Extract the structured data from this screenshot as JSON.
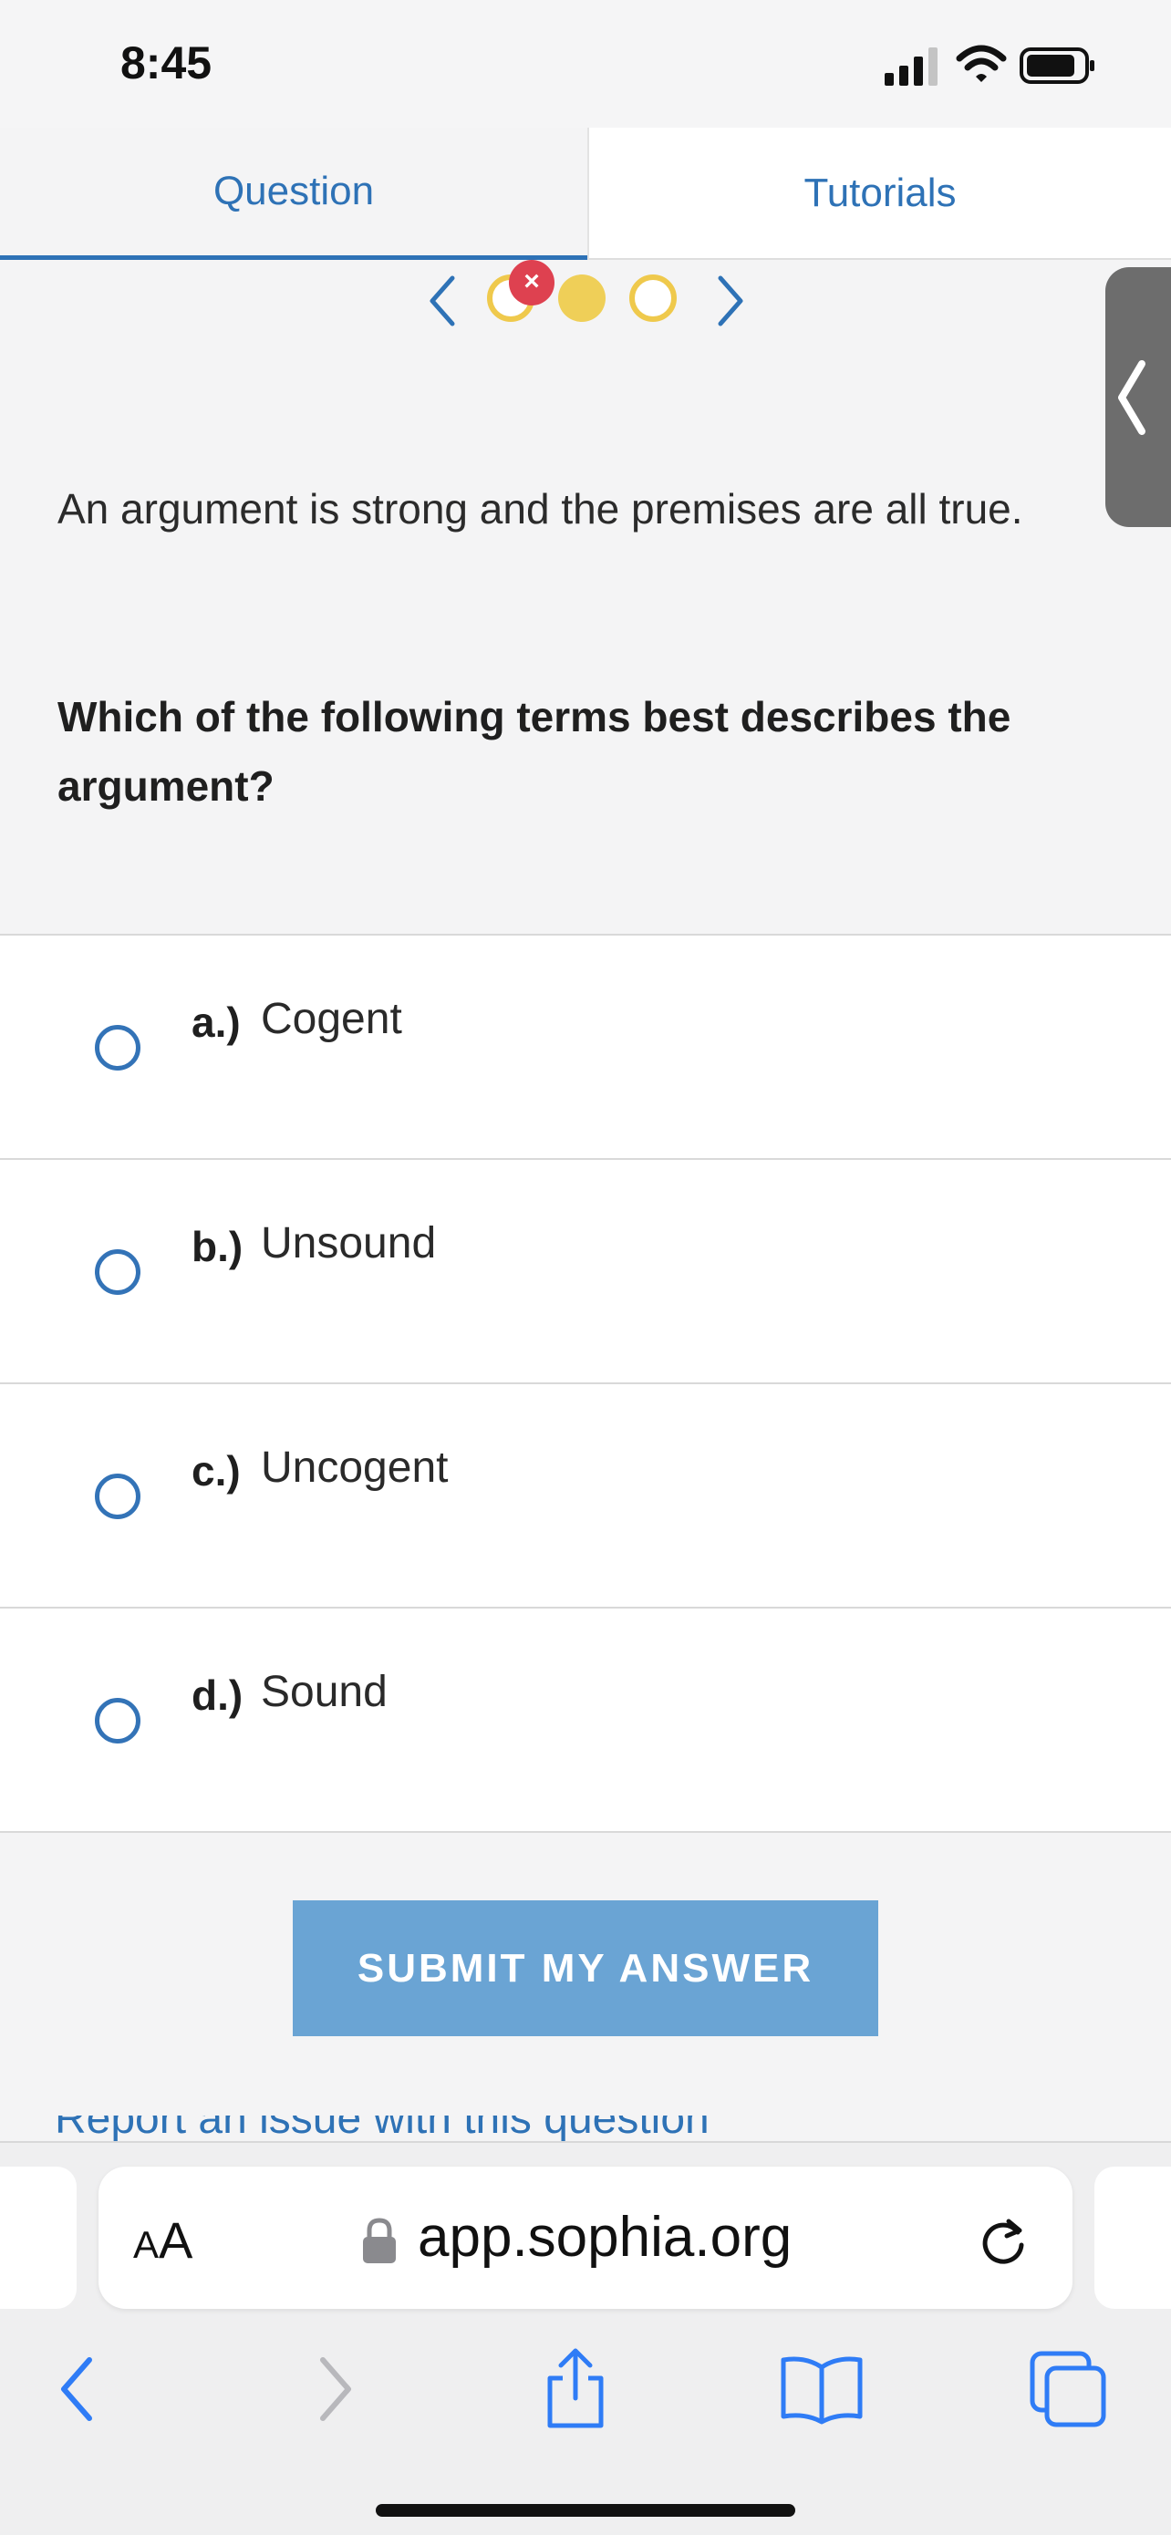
{
  "status": {
    "time": "8:45"
  },
  "tabs": [
    {
      "label": "Question",
      "active": true
    },
    {
      "label": "Tutorials",
      "active": false
    }
  ],
  "question_nav": {
    "dots": [
      {
        "state": "answered-incorrect",
        "color": "#efc94c",
        "badge": "×"
      },
      {
        "state": "current",
        "color": "#efcf58"
      },
      {
        "state": "unanswered",
        "color": "#efc94c"
      }
    ]
  },
  "question": {
    "prompt": "An argument is strong and the premises are all true.",
    "text": "Which of the following terms best describes the argument?"
  },
  "options": [
    {
      "letter": "a.)",
      "text": "Cogent"
    },
    {
      "letter": "b.)",
      "text": "Unsound"
    },
    {
      "letter": "c.)",
      "text": "Uncogent"
    },
    {
      "letter": "d.)",
      "text": "Sound"
    }
  ],
  "submit_label": "SUBMIT MY ANSWER",
  "report_link": "Report an issue with this question",
  "browser": {
    "aa_label_big": "A",
    "aa_label_small": "A",
    "url": "app.sophia.org"
  },
  "colors": {
    "accent": "#2e72b6",
    "submit": "#6aa4d4",
    "dot_yellow": "#efc94c",
    "badge_red": "#de4150"
  }
}
